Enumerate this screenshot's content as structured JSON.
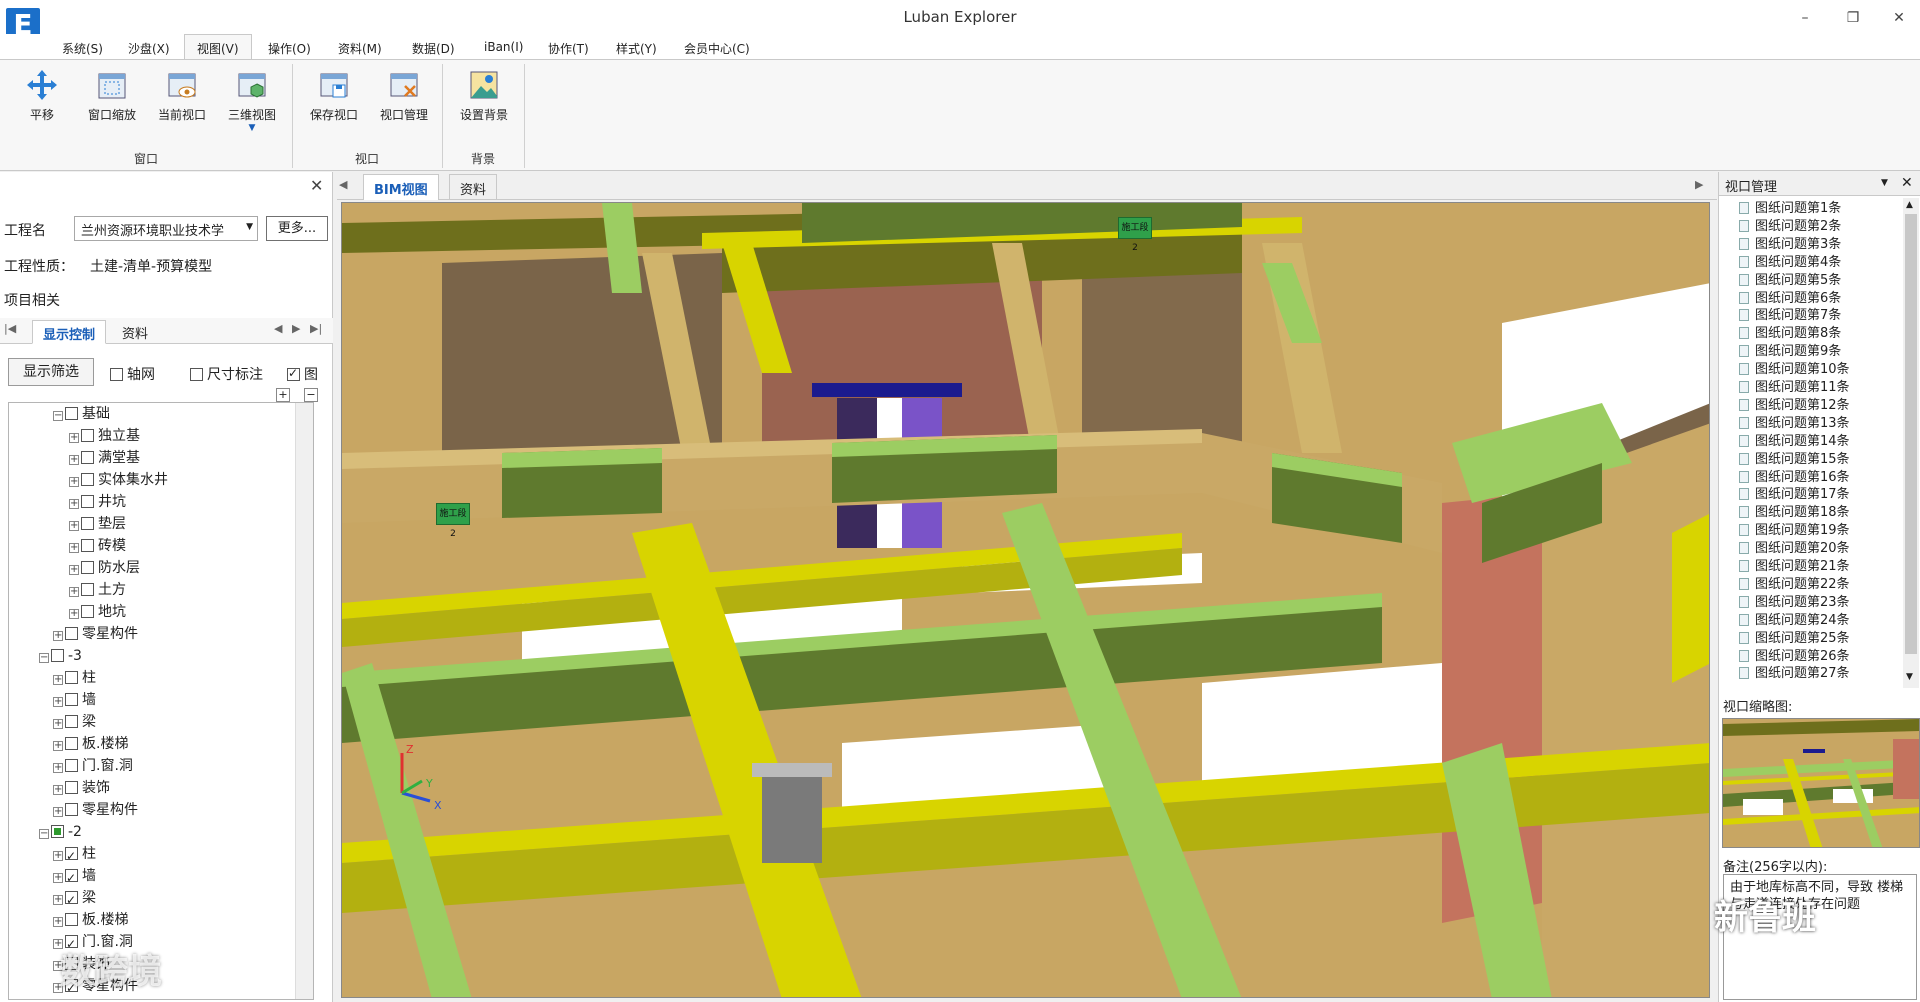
{
  "window": {
    "title": "Luban Explorer",
    "minimize": "–",
    "maximize": "❐",
    "close": "✕"
  },
  "menu": [
    "系统(S)",
    "沙盘(X)",
    "视图(V)",
    "操作(O)",
    "资料(M)",
    "数据(D)",
    "iBan(I)",
    "协作(T)",
    "样式(Y)",
    "会员中心(C)"
  ],
  "ribbon": {
    "buttons": [
      {
        "label": "平移",
        "icon": "pan-icon"
      },
      {
        "label": "窗口缩放",
        "icon": "window-zoom-icon"
      },
      {
        "label": "当前视口",
        "icon": "current-viewport-icon"
      },
      {
        "label": "三维视图",
        "icon": "3d-view-icon"
      },
      {
        "label": "保存视口",
        "icon": "save-viewport-icon"
      },
      {
        "label": "视口管理",
        "icon": "viewport-manage-icon"
      },
      {
        "label": "设置背景",
        "icon": "set-background-icon"
      }
    ],
    "groups": [
      "窗口",
      "视口",
      "背景"
    ]
  },
  "left_panel": {
    "project_label": "工程名",
    "project_value": "兰州资源环境职业技术学",
    "more_button": "更多...",
    "property_label": "工程性质：",
    "property_value": "土建-清单-预算模型",
    "related_label": "项目相关",
    "tabs": [
      "显示控制",
      "资料"
    ],
    "filter_button": "显示筛选",
    "checks": [
      {
        "label": "轴网",
        "checked": false
      },
      {
        "label": "尺寸标注",
        "checked": false
      },
      {
        "label": "图",
        "checked": true
      }
    ],
    "tree": [
      {
        "label": "基础",
        "level": 1,
        "state": "off",
        "expander": "−"
      },
      {
        "label": "独立基",
        "level": 2,
        "state": "off",
        "expander": "+"
      },
      {
        "label": "满堂基",
        "level": 2,
        "state": "off",
        "expander": "+"
      },
      {
        "label": "实体集水井",
        "level": 2,
        "state": "off",
        "expander": "+"
      },
      {
        "label": "井坑",
        "level": 2,
        "state": "off",
        "expander": "+"
      },
      {
        "label": "垫层",
        "level": 2,
        "state": "off",
        "expander": "+"
      },
      {
        "label": "砖模",
        "level": 2,
        "state": "off",
        "expander": "+"
      },
      {
        "label": "防水层",
        "level": 2,
        "state": "off",
        "expander": "+"
      },
      {
        "label": "土方",
        "level": 2,
        "state": "off",
        "expander": "+"
      },
      {
        "label": "地坑",
        "level": 2,
        "state": "off",
        "expander": "+"
      },
      {
        "label": "零星构件",
        "level": 1,
        "state": "off",
        "expander": "+"
      },
      {
        "label": "-3",
        "level": 0,
        "state": "off",
        "expander": "−"
      },
      {
        "label": "柱",
        "level": 1,
        "state": "off",
        "expander": "+"
      },
      {
        "label": "墙",
        "level": 1,
        "state": "off",
        "expander": "+"
      },
      {
        "label": "梁",
        "level": 1,
        "state": "off",
        "expander": "+"
      },
      {
        "label": "板.楼梯",
        "level": 1,
        "state": "off",
        "expander": "+"
      },
      {
        "label": "门.窗.洞",
        "level": 1,
        "state": "off",
        "expander": "+"
      },
      {
        "label": "装饰",
        "level": 1,
        "state": "off",
        "expander": "+"
      },
      {
        "label": "零星构件",
        "level": 1,
        "state": "off",
        "expander": "+"
      },
      {
        "label": "-2",
        "level": 0,
        "state": "partial",
        "expander": "−"
      },
      {
        "label": "柱",
        "level": 1,
        "state": "on",
        "expander": "+"
      },
      {
        "label": "墙",
        "level": 1,
        "state": "on",
        "expander": "+"
      },
      {
        "label": "梁",
        "level": 1,
        "state": "on",
        "expander": "+"
      },
      {
        "label": "板.楼梯",
        "level": 1,
        "state": "off",
        "expander": "+"
      },
      {
        "label": "门.窗.洞",
        "level": 1,
        "state": "on",
        "expander": "+"
      },
      {
        "label": "装饰",
        "level": 1,
        "state": "off",
        "expander": "+"
      },
      {
        "label": "零星构件",
        "level": 1,
        "state": "on",
        "expander": "+"
      }
    ]
  },
  "viewport": {
    "tabs": [
      "BIM视图",
      "资料"
    ],
    "tags": [
      "施工段2",
      "施工段2"
    ],
    "axes": {
      "z": "Z",
      "x": "X",
      "y": "Y"
    }
  },
  "right_panel": {
    "title": "视口管理",
    "items": [
      "图纸问题第1条",
      "图纸问题第2条",
      "图纸问题第3条",
      "图纸问题第4条",
      "图纸问题第5条",
      "图纸问题第6条",
      "图纸问题第7条",
      "图纸问题第8条",
      "图纸问题第9条",
      "图纸问题第10条",
      "图纸问题第11条",
      "图纸问题第12条",
      "图纸问题第13条",
      "图纸问题第14条",
      "图纸问题第15条",
      "图纸问题第16条",
      "图纸问题第17条",
      "图纸问题第18条",
      "图纸问题第19条",
      "图纸问题第20条",
      "图纸问题第21条",
      "图纸问题第22条",
      "图纸问题第23条",
      "图纸问题第24条",
      "图纸问题第25条",
      "图纸问题第26条",
      "图纸问题第27条"
    ],
    "thumb_label": "视口缩略图:",
    "note_label": "备注(256字以内):",
    "note_text": "由于地库标高不同，导致 楼梯与走道连接处存在问题"
  },
  "watermarks": {
    "left": "数跨境",
    "right": "新鲁班"
  },
  "colors": {
    "accent": "#1b5fb8",
    "wall": "#c9a866",
    "beam_yellow": "#d8d400",
    "beam_green": "#9ccd62",
    "dark_olive": "#6e6f1c"
  }
}
